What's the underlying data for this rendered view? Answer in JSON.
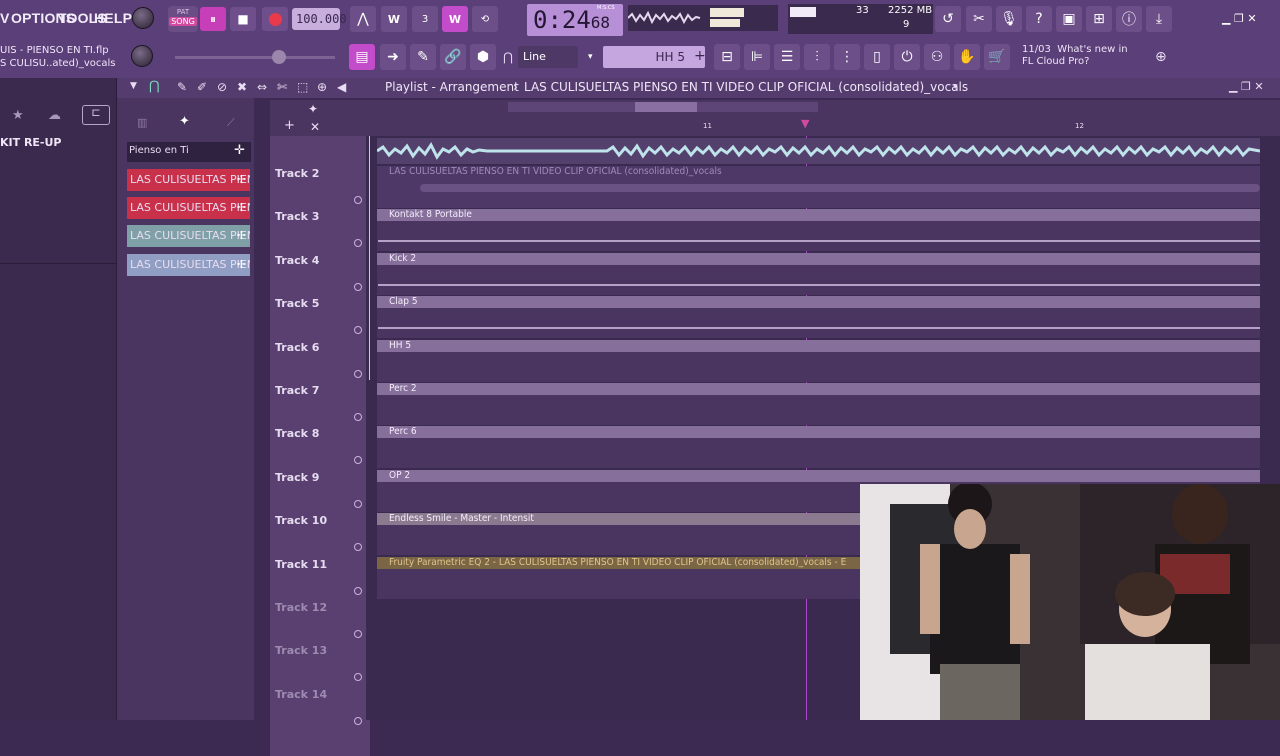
{
  "menu": {
    "items": [
      "V",
      "OPTIONS",
      "TOOLS",
      "HELP"
    ]
  },
  "transport": {
    "pat_label": "PAT",
    "song_label": "SONG",
    "tempo": "100.000",
    "time": "0:24",
    "time_sub": "68",
    "time_unit": "M:S:CS"
  },
  "cpu": {
    "value": "33",
    "memory": "2252 MB",
    "polyphony": "9"
  },
  "snap": {
    "mode": "Line"
  },
  "channel": {
    "name": "HH 5"
  },
  "news": {
    "date": "11/03",
    "text": "What's new in FL Cloud Pro?"
  },
  "project": {
    "file_line1": "UIS - PIENSO EN TI.flp",
    "file_line2": "S CULISU..ated)_vocals"
  },
  "browser": {
    "title": "KIT RE-UP"
  },
  "playlist": {
    "title": "Playlist - Arrangement",
    "name": "LAS CULISUELTAS PIENSO EN TI VIDEO CLIP OFICIAL (consolidated)_vocals",
    "bar11": "11",
    "bar12": "12"
  },
  "picker": {
    "header": "Pienso en Ti",
    "items": [
      {
        "label": "LAS CULISUELTAS PIEN...",
        "color": "#c9304a"
      },
      {
        "label": "LAS CULISUELTAS PIEN...",
        "color": "#c9304a"
      },
      {
        "label": "LAS CULISUELTAS PIEN...",
        "color": "#7fa0a6"
      },
      {
        "label": "LAS CULISUELTAS PIEN...",
        "color": "#8f9ec2"
      }
    ]
  },
  "tracks": [
    {
      "label": "Track 2",
      "clip": "LAS CULISUELTAS PIENSO EN TI VIDEO CLIP OFICIAL (consolidated)_vocals"
    },
    {
      "label": "Track 3",
      "clip": "Kontakt 8 Portable"
    },
    {
      "label": "Track 4",
      "clip": "Kick 2"
    },
    {
      "label": "Track 5",
      "clip": "Clap 5"
    },
    {
      "label": "Track 6",
      "clip": "HH 5"
    },
    {
      "label": "Track 7",
      "clip": "Perc 2"
    },
    {
      "label": "Track 8",
      "clip": "Perc 6"
    },
    {
      "label": "Track 9",
      "clip": "OP 2"
    },
    {
      "label": "Track 10",
      "clip": "Endless Smile - Master - Intensit"
    },
    {
      "label": "Track 11",
      "clip": "Fruity Parametric EQ 2 - LAS CULISUELTAS PIENSO EN TI VIDEO CLIP OFICIAL (consolidated)_vocals - E"
    },
    {
      "label": "Track 12",
      "clip": ""
    },
    {
      "label": "Track 13",
      "clip": ""
    },
    {
      "label": "Track 14",
      "clip": ""
    }
  ],
  "colors": {
    "accent": "#b78fd6",
    "bg": "#3b2a4f",
    "clip_header": "#86709b",
    "eq_clip": "#e0c48a"
  }
}
